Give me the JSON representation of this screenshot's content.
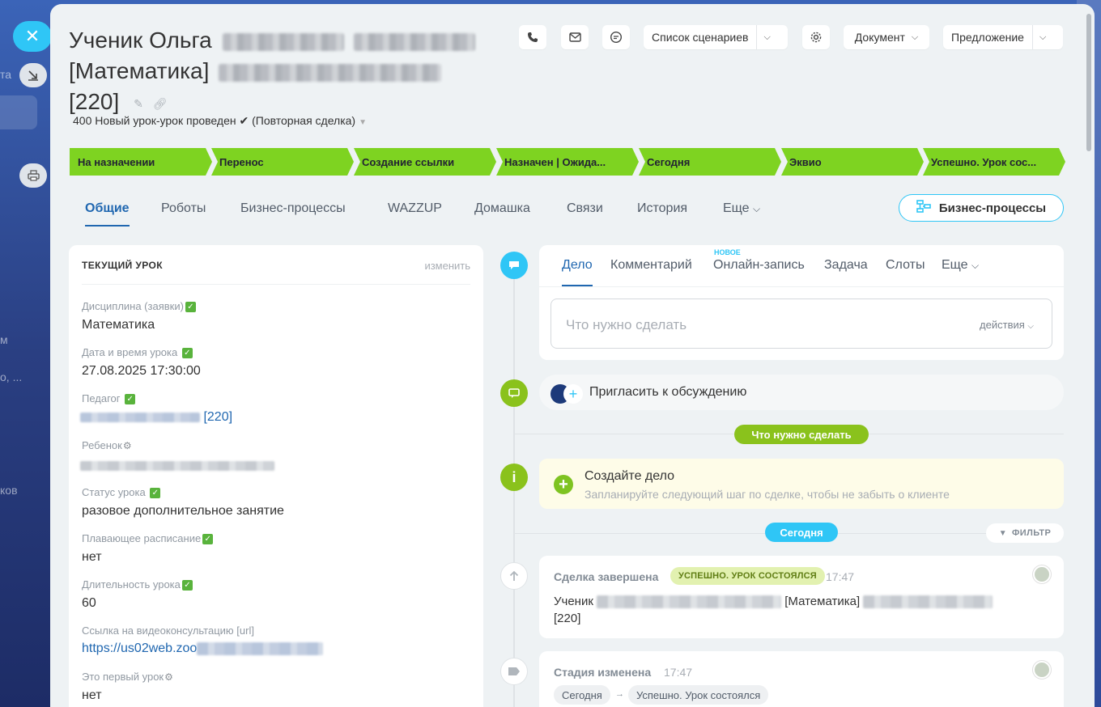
{
  "sidebar": {
    "close_symbol": "✕",
    "texts": [
      "та",
      "м",
      "о, ...",
      "ков"
    ]
  },
  "header": {
    "title_line1": "Ученик Ольга",
    "title_line2": "[Математика]",
    "title_line3": "[220]",
    "subline": "400 Новый урок-урок проведен ✔ (Повторная сделка)",
    "buttons": {
      "scenarios": "Список сценариев",
      "document": "Документ",
      "proposal": "Предложение"
    }
  },
  "stages": [
    "На назначении",
    "Перенос",
    "Создание ссылки",
    "Назначен | Ожида...",
    "Сегодня",
    "Эквио",
    "Успешно. Урок сос..."
  ],
  "tabs": [
    "Общие",
    "Роботы",
    "Бизнес-процессы",
    "WAZZUP",
    "Домашка",
    "Связи",
    "История",
    "Еще"
  ],
  "bp_button": "Бизнес-процессы",
  "current_lesson": {
    "header": "ТЕКУЩИЙ УРОК",
    "edit": "изменить",
    "fields": [
      {
        "label": "Дисциплина (заявки)",
        "value": "Математика"
      },
      {
        "label": "Дата и время урока ",
        "value": "27.08.2025 17:30:00"
      },
      {
        "label": "Педагог ",
        "value": "[220]"
      },
      {
        "label": "Ребенок",
        "value": ""
      },
      {
        "label": "Статус урока ",
        "value": "разовое дополнительное занятие"
      },
      {
        "label": "Плавающее расписание",
        "value": "нет"
      },
      {
        "label": "Длительность урока",
        "value": "60"
      },
      {
        "label": "Ссылка на видеоконсультацию [url]",
        "value": "https://us02web.zoo"
      },
      {
        "label": "Это первый урок",
        "value": "нет"
      }
    ]
  },
  "activity": {
    "tabs": [
      "Дело",
      "Комментарий",
      "Онлайн-запись",
      "Задача",
      "Слоты",
      "Еще"
    ],
    "new_badge": "НОВОЕ",
    "placeholder": "Что нужно сделать",
    "actions": "действия"
  },
  "invite": "Пригласить к обсуждению",
  "todo_pill": "Что нужно сделать",
  "create_deal": {
    "title": "Создайте дело",
    "subtitle": "Запланируйте следующий шаг по сделке, чтобы не забыть о клиенте"
  },
  "today_pill": "Сегодня",
  "filter": "ФИЛЬТР",
  "events": [
    {
      "title": "Сделка завершена",
      "badge": "УСПЕШНО. УРОК СОСТОЯЛСЯ",
      "time": "17:47",
      "body_prefix": "Ученик",
      "body_mid": "[Математика]",
      "body_end": "[220]"
    },
    {
      "title": "Стадия изменена",
      "time": "17:47",
      "from": "Сегодня",
      "to": "Успешно. Урок состоялся"
    }
  ],
  "colors": {
    "accent": "#2fc6f6",
    "stage_green": "#7ed321",
    "link_blue": "#2067b0"
  }
}
